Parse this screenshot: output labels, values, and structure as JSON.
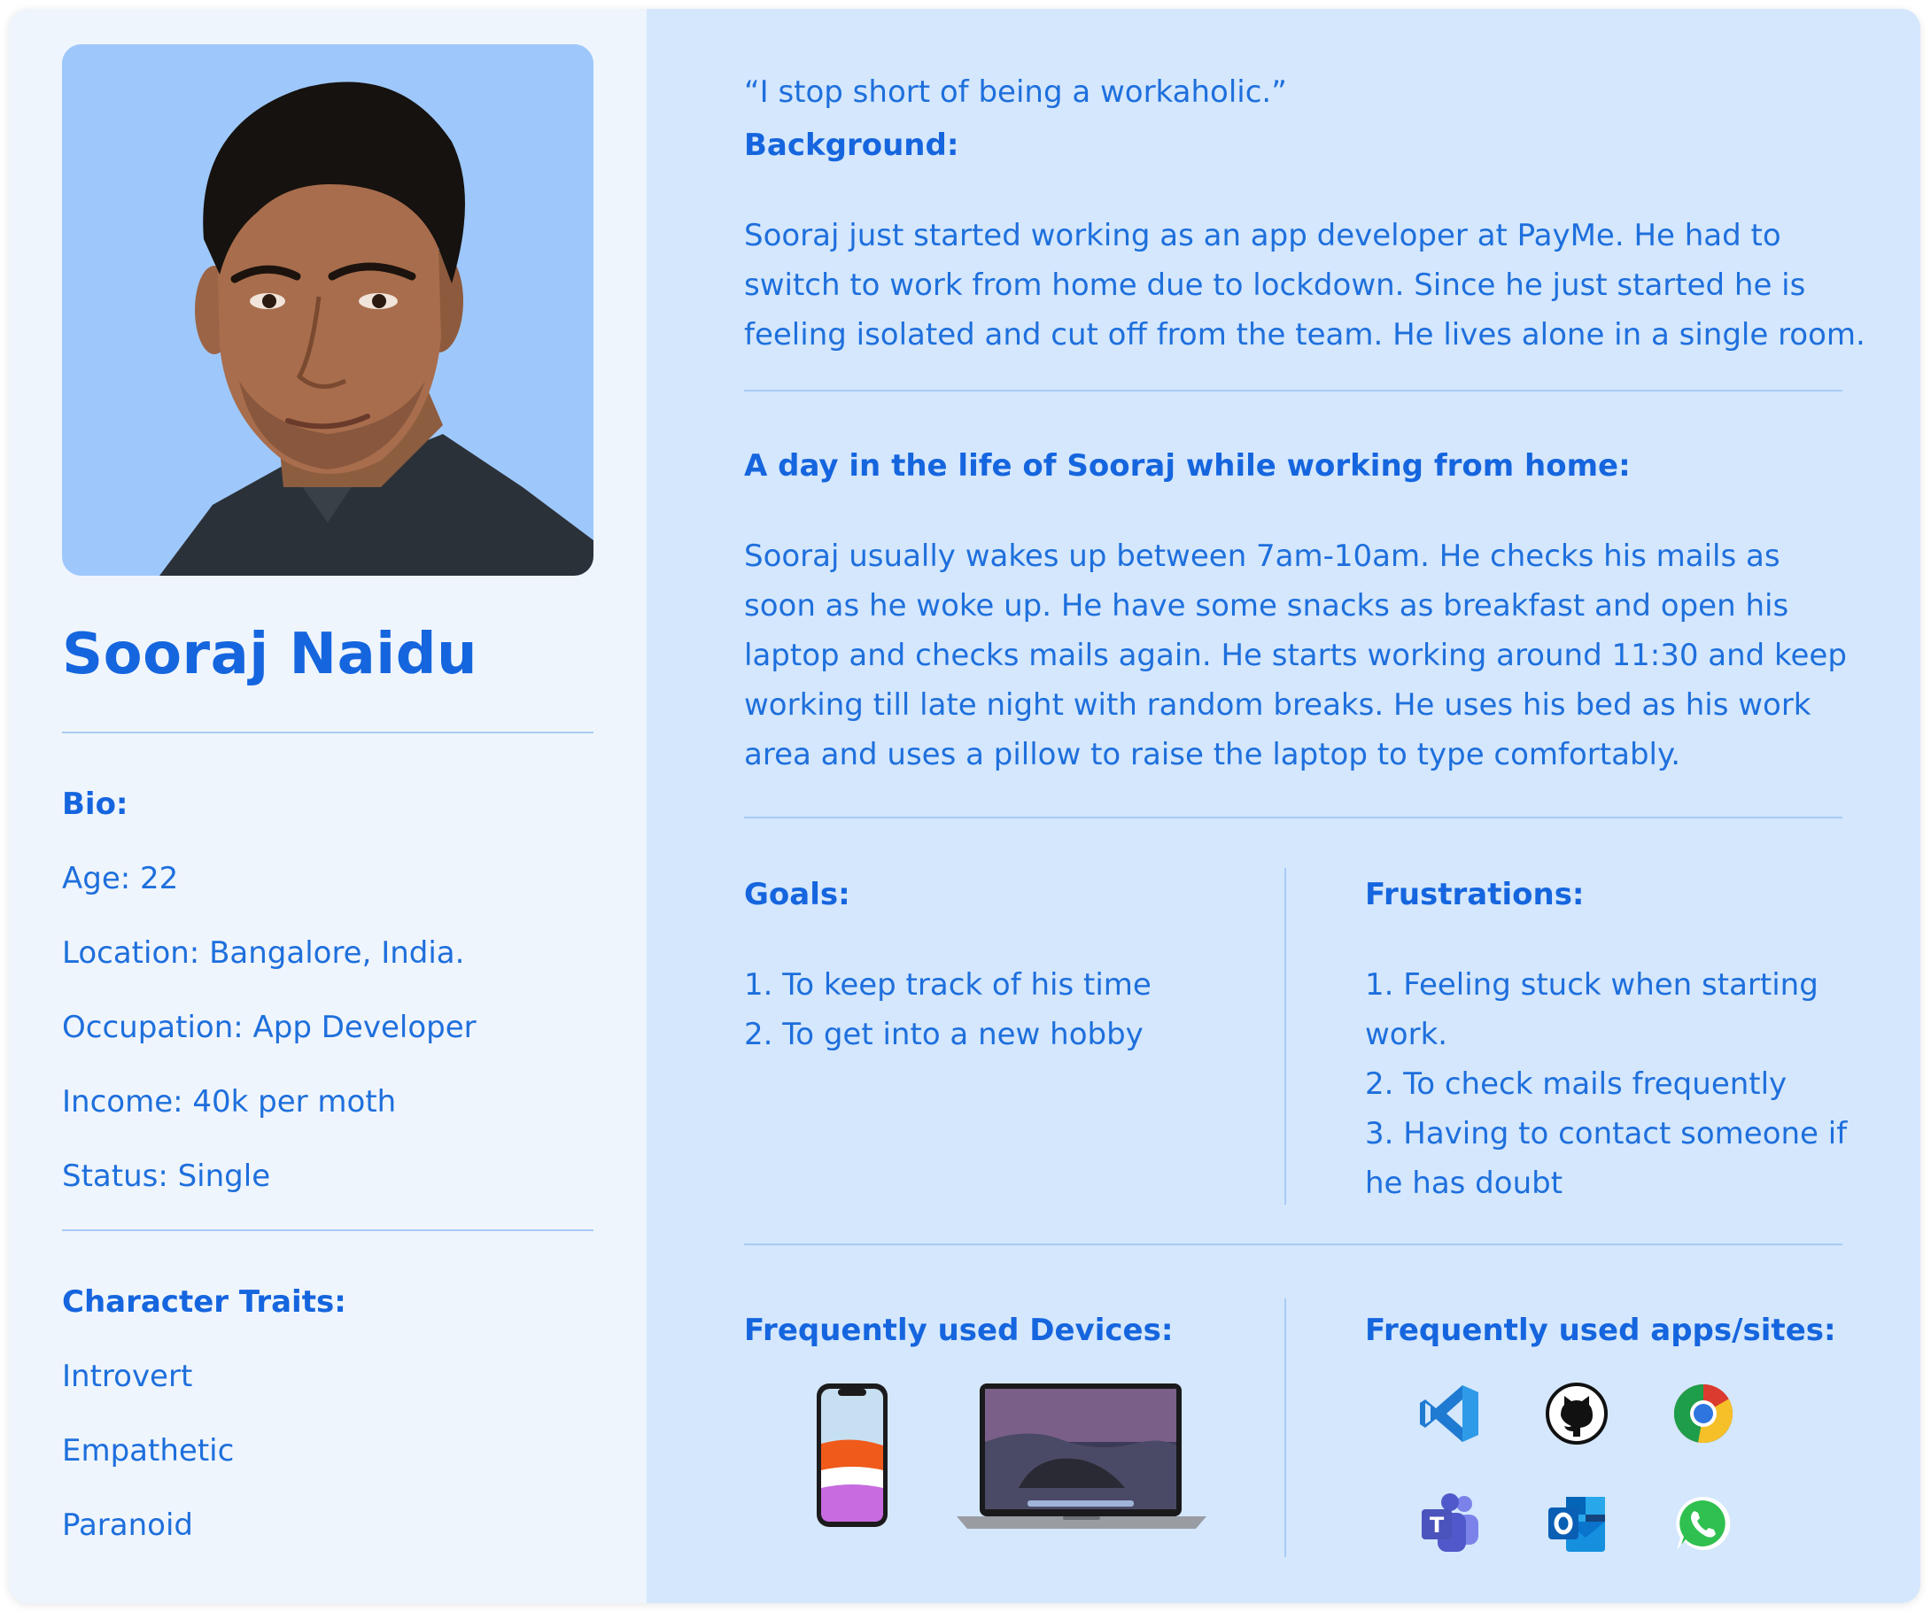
{
  "persona": {
    "name": "Sooraj Naidu",
    "bio": {
      "heading": "Bio:",
      "items": [
        "Age: 22",
        "Location: Bangalore, India.",
        "Occupation: App Developer",
        "Income: 40k per moth",
        "Status: Single"
      ]
    },
    "traits": {
      "heading": "Character Traits:",
      "items": [
        "Introvert",
        "Empathetic",
        "Paranoid"
      ]
    }
  },
  "quote": "“I stop short of being a workaholic.”",
  "background": {
    "heading": "Background:",
    "text": "Sooraj just started working as an app developer at PayMe. He had to switch to work from home due to lockdown. Since he just started he is feeling isolated and cut off from the team. He lives alone in a single room."
  },
  "day": {
    "heading": "A day in the life of Sooraj while working from home:",
    "text": "Sooraj usually wakes up between 7am-10am.  He checks his mails as soon as he woke up. He have some snacks as breakfast and open his laptop and checks mails again. He starts working around 11:30 and keep working till late night with random breaks. He uses his bed as his work area and uses a pillow to raise the laptop to type comfortably."
  },
  "goals": {
    "heading": "Goals:",
    "items": [
      "1. To keep track of his time",
      "2. To get into a new hobby"
    ]
  },
  "frustrations": {
    "heading": "Frustrations:",
    "items": [
      "1. Feeling stuck when starting work.",
      "2. To check mails frequently",
      "3. Having to contact someone if he has doubt"
    ]
  },
  "devices": {
    "heading": "Frequently used Devices:",
    "items": [
      "iphone-icon",
      "macbook-icon"
    ]
  },
  "apps": {
    "heading": "Frequently used apps/sites:",
    "items": [
      "vscode-icon",
      "github-icon",
      "chrome-icon",
      "teams-icon",
      "outlook-icon",
      "whatsapp-icon"
    ]
  },
  "colors": {
    "accent": "#1565de",
    "left_panel": "#eff5fd",
    "right_panel": "#d4e7fd",
    "photo_bg": "#9ec8fb"
  }
}
